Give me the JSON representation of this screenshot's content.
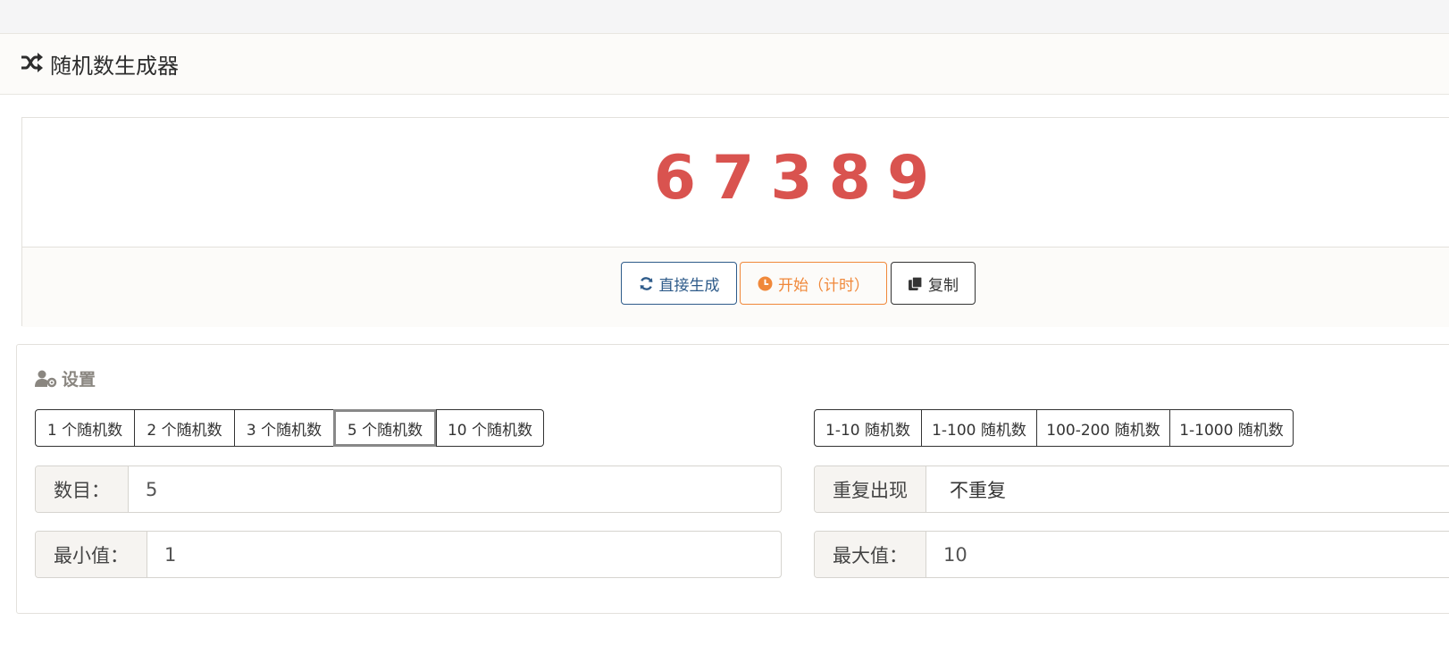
{
  "header": {
    "title": "随机数生成器",
    "icon": "shuffle-icon"
  },
  "result": {
    "value": "67389"
  },
  "actions": {
    "generate_label": "直接生成",
    "start_label": "开始（计时）",
    "copy_label": "复制"
  },
  "settings": {
    "title": "设置",
    "count_presets": [
      "1 个随机数",
      "2 个随机数",
      "3 个随机数",
      "5 个随机数",
      "10 个随机数"
    ],
    "count_selected": "5 个随机数",
    "range_presets": [
      "1-10 随机数",
      "1-100 随机数",
      "100-200 随机数",
      "1-1000 随机数"
    ],
    "count": {
      "label": "数目：",
      "value": "5"
    },
    "repeat": {
      "label": "重复出现",
      "value": "不重复"
    },
    "min": {
      "label": "最小值：",
      "value": "1"
    },
    "max": {
      "label": "最大值：",
      "value": "10"
    }
  },
  "colors": {
    "result": "#d9534f",
    "generate": "#2e5b8a",
    "start": "#f0883a"
  }
}
